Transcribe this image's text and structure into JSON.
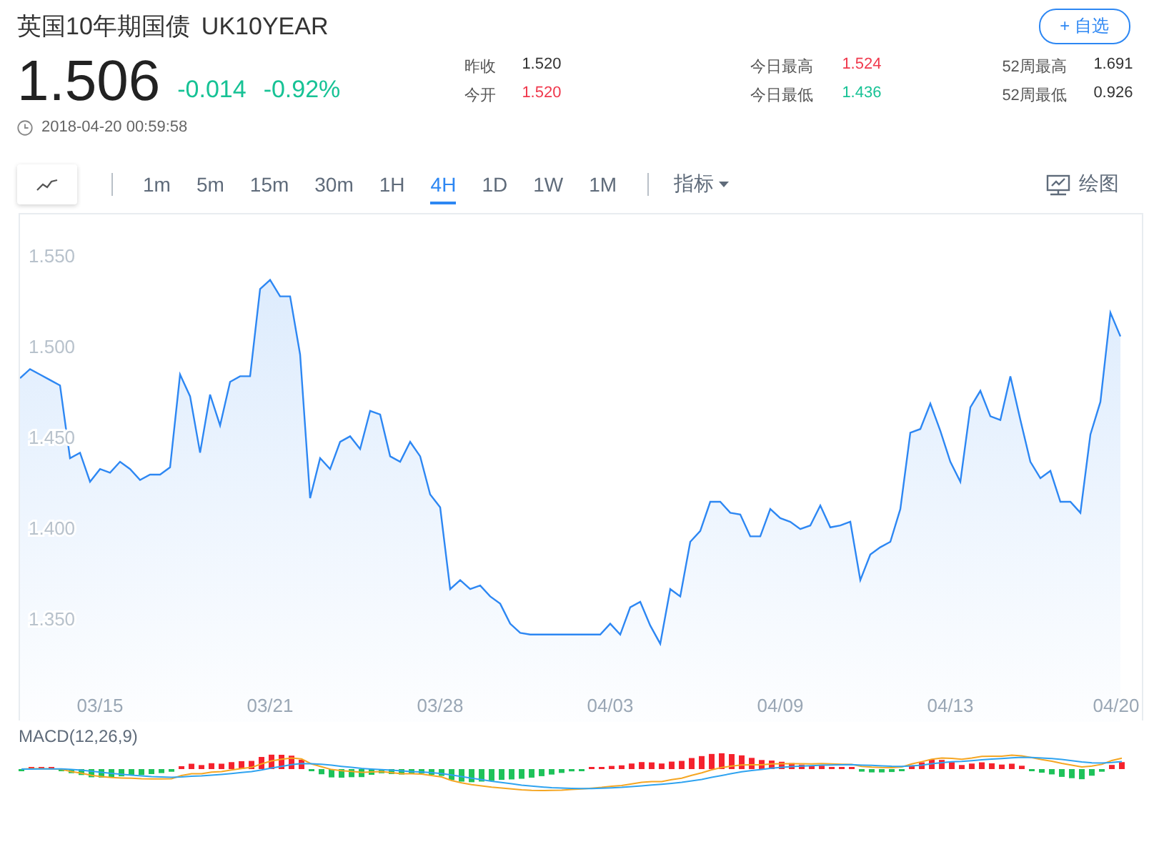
{
  "header": {
    "name": "英国10年期国债",
    "code": "UK10YEAR",
    "watch_button": "+ 自选"
  },
  "quote": {
    "price": "1.506",
    "change": "-0.014",
    "change_pct": "-0.92%",
    "timestamp": "2018-04-20 00:59:58"
  },
  "stats": [
    [
      {
        "label": "昨收",
        "value": "1.520",
        "color": "#333333"
      },
      {
        "label": "今开",
        "value": "1.520",
        "color": "#f0394d"
      }
    ],
    [
      {
        "label": "今日最高",
        "value": "1.524",
        "color": "#f0394d"
      },
      {
        "label": "今日最低",
        "value": "1.436",
        "color": "#17c295"
      }
    ],
    [
      {
        "label": "52周最高",
        "value": "1.691",
        "color": "#333333"
      },
      {
        "label": "52周最低",
        "value": "0.926",
        "color": "#333333"
      }
    ]
  ],
  "intervals": [
    {
      "label": "1m",
      "selected": false
    },
    {
      "label": "5m",
      "selected": false
    },
    {
      "label": "15m",
      "selected": false
    },
    {
      "label": "30m",
      "selected": false
    },
    {
      "label": "1H",
      "selected": false
    },
    {
      "label": "4H",
      "selected": true
    },
    {
      "label": "1D",
      "selected": false
    },
    {
      "label": "1W",
      "selected": false
    },
    {
      "label": "1M",
      "selected": false
    }
  ],
  "indicator_menu": "指标",
  "draw_button": "绘图",
  "chart": {
    "chart_data": {
      "type": "area",
      "yticks": [
        {
          "value": 1.35,
          "label": "1.350"
        },
        {
          "value": 1.4,
          "label": "1.400"
        },
        {
          "value": 1.45,
          "label": "1.450"
        },
        {
          "value": 1.5,
          "label": "1.500"
        },
        {
          "value": 1.55,
          "label": "1.550"
        }
      ],
      "ylim": [
        1.294,
        1.573
      ],
      "categories": [
        null,
        null,
        null,
        null,
        null,
        null,
        null,
        null,
        "03/15",
        null,
        null,
        null,
        null,
        null,
        null,
        null,
        null,
        null,
        null,
        null,
        null,
        null,
        null,
        null,
        null,
        "03/21",
        null,
        null,
        null,
        null,
        null,
        null,
        null,
        null,
        null,
        null,
        null,
        null,
        null,
        null,
        null,
        null,
        "03/28",
        null,
        null,
        null,
        null,
        null,
        null,
        null,
        null,
        null,
        null,
        null,
        null,
        null,
        null,
        null,
        null,
        "04/03",
        null,
        null,
        null,
        null,
        null,
        null,
        null,
        null,
        null,
        null,
        null,
        null,
        null,
        null,
        null,
        null,
        "04/09",
        null,
        null,
        null,
        null,
        null,
        null,
        null,
        null,
        null,
        null,
        null,
        null,
        null,
        null,
        null,
        null,
        "04/13",
        null,
        null,
        null,
        null,
        null,
        null,
        null,
        null,
        null,
        null,
        null,
        null,
        null,
        null,
        null,
        null,
        "04/20"
      ],
      "series": [
        {
          "color": "#2d87f3",
          "values": [
            1.483,
            1.488,
            1.485,
            1.482,
            1.479,
            1.439,
            1.442,
            1.426,
            1.433,
            1.431,
            1.437,
            1.433,
            1.427,
            1.43,
            1.43,
            1.434,
            1.485,
            1.473,
            1.442,
            1.474,
            1.457,
            1.481,
            1.484,
            1.484,
            1.532,
            1.537,
            1.528,
            1.528,
            1.496,
            1.417,
            1.439,
            1.433,
            1.448,
            1.451,
            1.444,
            1.465,
            1.463,
            1.44,
            1.437,
            1.448,
            1.44,
            1.419,
            1.412,
            1.367,
            1.372,
            1.367,
            1.369,
            1.363,
            1.359,
            1.348,
            1.343,
            1.342,
            1.342,
            1.342,
            1.342,
            1.342,
            1.342,
            1.342,
            1.342,
            1.348,
            1.342,
            1.357,
            1.36,
            1.347,
            1.337,
            1.367,
            1.363,
            1.393,
            1.399,
            1.415,
            1.415,
            1.409,
            1.408,
            1.396,
            1.396,
            1.411,
            1.406,
            1.404,
            1.4,
            1.402,
            1.413,
            1.401,
            1.402,
            1.404,
            1.372,
            1.386,
            1.39,
            1.393,
            1.411,
            1.453,
            1.455,
            1.469,
            1.454,
            1.437,
            1.426,
            1.467,
            1.476,
            1.462,
            1.46,
            1.484,
            1.46,
            1.437,
            1.428,
            1.432,
            1.415,
            1.415,
            1.409,
            1.452,
            1.47,
            1.519,
            1.506
          ]
        }
      ]
    }
  },
  "macd": {
    "label": "MACD(12,26,9)"
  }
}
